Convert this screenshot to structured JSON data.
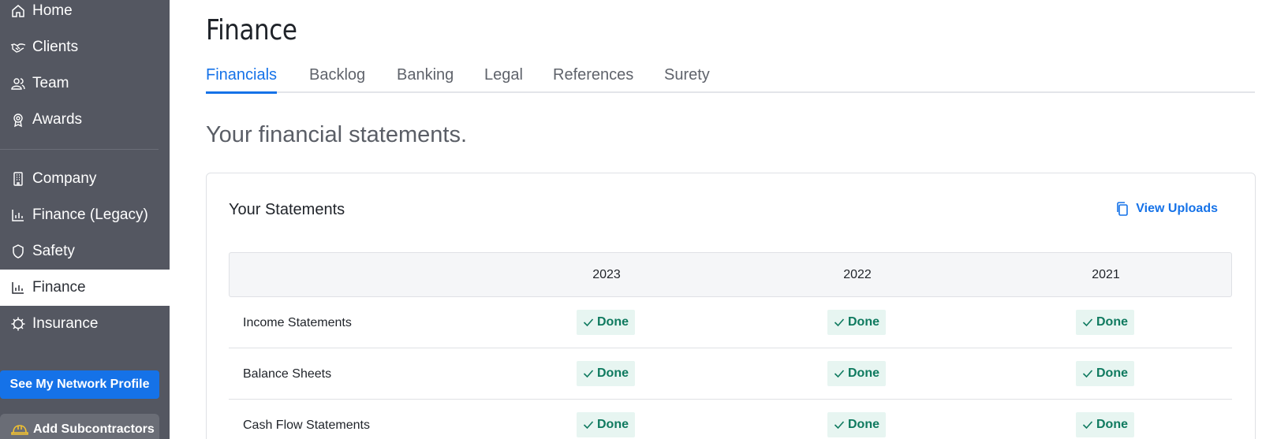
{
  "sidebar": {
    "items": [
      {
        "label": "Home",
        "icon": "home-icon"
      },
      {
        "label": "Clients",
        "icon": "handshake-icon"
      },
      {
        "label": "Team",
        "icon": "team-icon"
      },
      {
        "label": "Awards",
        "icon": "award-icon"
      },
      {
        "label": "Company",
        "icon": "building-icon"
      },
      {
        "label": "Finance (Legacy)",
        "icon": "chart-icon"
      },
      {
        "label": "Safety",
        "icon": "shield-icon"
      },
      {
        "label": "Finance",
        "icon": "chart-icon",
        "active": true
      },
      {
        "label": "Insurance",
        "icon": "gear-icon"
      }
    ],
    "network_button": "See My Network Profile",
    "subs_button": "Add Subcontractors"
  },
  "page": {
    "title": "Finance",
    "subtitle": "Your financial statements."
  },
  "tabs": [
    {
      "label": "Financials",
      "active": true
    },
    {
      "label": "Backlog"
    },
    {
      "label": "Banking"
    },
    {
      "label": "Legal"
    },
    {
      "label": "References"
    },
    {
      "label": "Surety"
    }
  ],
  "card": {
    "title": "Your Statements",
    "view_uploads": "View Uploads",
    "columns": [
      "2023",
      "2022",
      "2021"
    ],
    "rows": [
      {
        "label": "Income Statements",
        "statuses": [
          "Done",
          "Done",
          "Done"
        ]
      },
      {
        "label": "Balance Sheets",
        "statuses": [
          "Done",
          "Done",
          "Done"
        ]
      },
      {
        "label": "Cash Flow Statements",
        "statuses": [
          "Done",
          "Done",
          "Done"
        ]
      }
    ]
  },
  "colors": {
    "accent": "#1572e8",
    "sidebar_bg": "#545761",
    "done_text": "#0f7a5f",
    "done_bg": "#e7f5f1"
  }
}
